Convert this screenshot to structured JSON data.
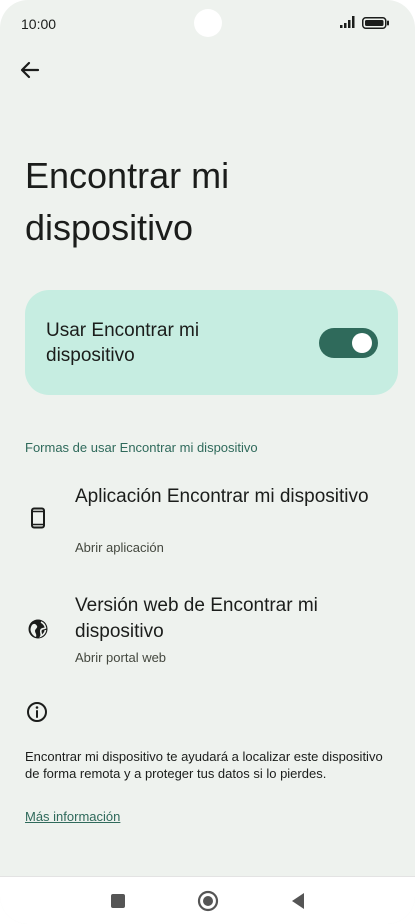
{
  "status_bar": {
    "time": "10:00"
  },
  "header": {
    "title": "Encontrar mi dispositivo"
  },
  "toggle": {
    "label": "Usar Encontrar mi dispositivo",
    "state": "on"
  },
  "section": {
    "title": "Formas de usar Encontrar mi dispositivo"
  },
  "items": [
    {
      "title": "Aplicación Encontrar mi dispositivo",
      "subtitle": "Abrir aplicación",
      "icon": "phone-icon"
    },
    {
      "title": "Versión web de Encontrar mi dispositivo",
      "subtitle": "Abrir portal web",
      "icon": "globe-icon"
    }
  ],
  "info": {
    "text": "Encontrar mi dispositivo te ayudará a localizar este dispositivo de forma remota y a proteger tus datos si lo pierdes.",
    "link": "Más información"
  },
  "colors": {
    "background": "#eef2ee",
    "card": "#c6ede1",
    "accent": "#2f6a5b"
  }
}
